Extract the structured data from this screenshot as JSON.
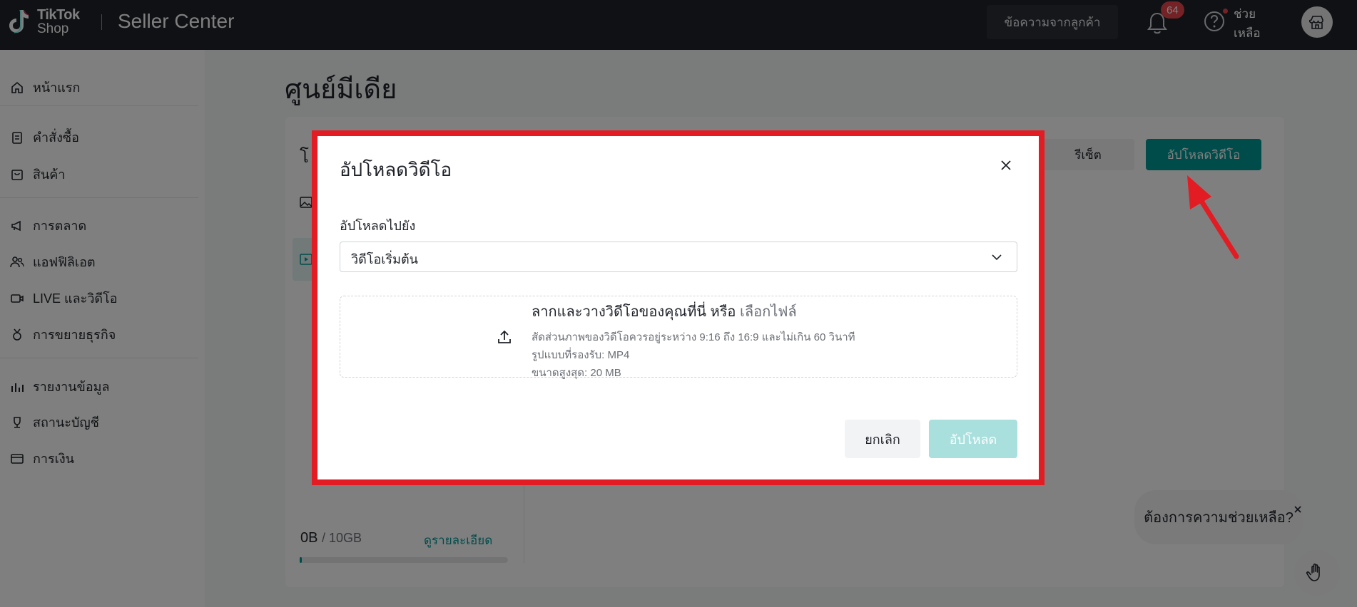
{
  "header": {
    "logo_line1": "TikTok",
    "logo_line2": "Shop",
    "product_name": "Seller Center",
    "customer_messages_label": "ข้อความจากลูกค้า",
    "notification_count": "64",
    "help_label": "ช่วย เหลือ"
  },
  "sidebar": {
    "items": [
      {
        "label": "หน้าแรก",
        "icon": "home-icon"
      },
      {
        "label": "คำสั่งซื้อ",
        "icon": "clipboard-icon"
      },
      {
        "label": "สินค้า",
        "icon": "bag-icon"
      },
      {
        "label": "การตลาด",
        "icon": "megaphone-icon"
      },
      {
        "label": "แอฟฟิลิเอต",
        "icon": "people-icon"
      },
      {
        "label": "LIVE และวิดีโอ",
        "icon": "video-icon"
      },
      {
        "label": "การขยายธุรกิจ",
        "icon": "medal-icon"
      },
      {
        "label": "รายงานข้อมูล",
        "icon": "bar-chart-icon"
      },
      {
        "label": "สถานะบัญชี",
        "icon": "trophy-icon"
      },
      {
        "label": "การเงิน",
        "icon": "wallet-icon"
      }
    ]
  },
  "main": {
    "page_title": "ศูนย์มีเดีย",
    "left_tab_fragment": "โ",
    "reset_label": "รีเซ็ต",
    "upload_video_label": "อัปโหลดวิดีโอ",
    "storage": {
      "used": "0B",
      "total": "/ 10GB",
      "detail_link": "ดูรายละเอียด",
      "used_fraction": 0.0
    }
  },
  "modal": {
    "title": "อัปโหลดวิดีโอ",
    "field_label": "อัปโหลดไปยัง",
    "select_value": "วิดีโอเริ่มต้น",
    "dropzone": {
      "main_text": "ลากและวางวิดีโอของคุณที่นี่ หรือ",
      "link_text": "เลือกไฟล์",
      "line1": "สัดส่วนภาพของวิดีโอควรอยู่ระหว่าง 9:16 ถึง 16:9 และไม่เกิน 60 วินาที",
      "line2": "รูปแบบที่รองรับ: MP4",
      "line3": "ขนาดสูงสุด: 20 MB"
    },
    "cancel_label": "ยกเลิก",
    "upload_label": "อัปโหลด"
  },
  "help_widget": {
    "bubble_text": "ต้องการความช่วยเหลือ?"
  },
  "colors": {
    "accent": "#009995",
    "highlight_frame": "#e31b23",
    "topbar": "#1f2229"
  }
}
